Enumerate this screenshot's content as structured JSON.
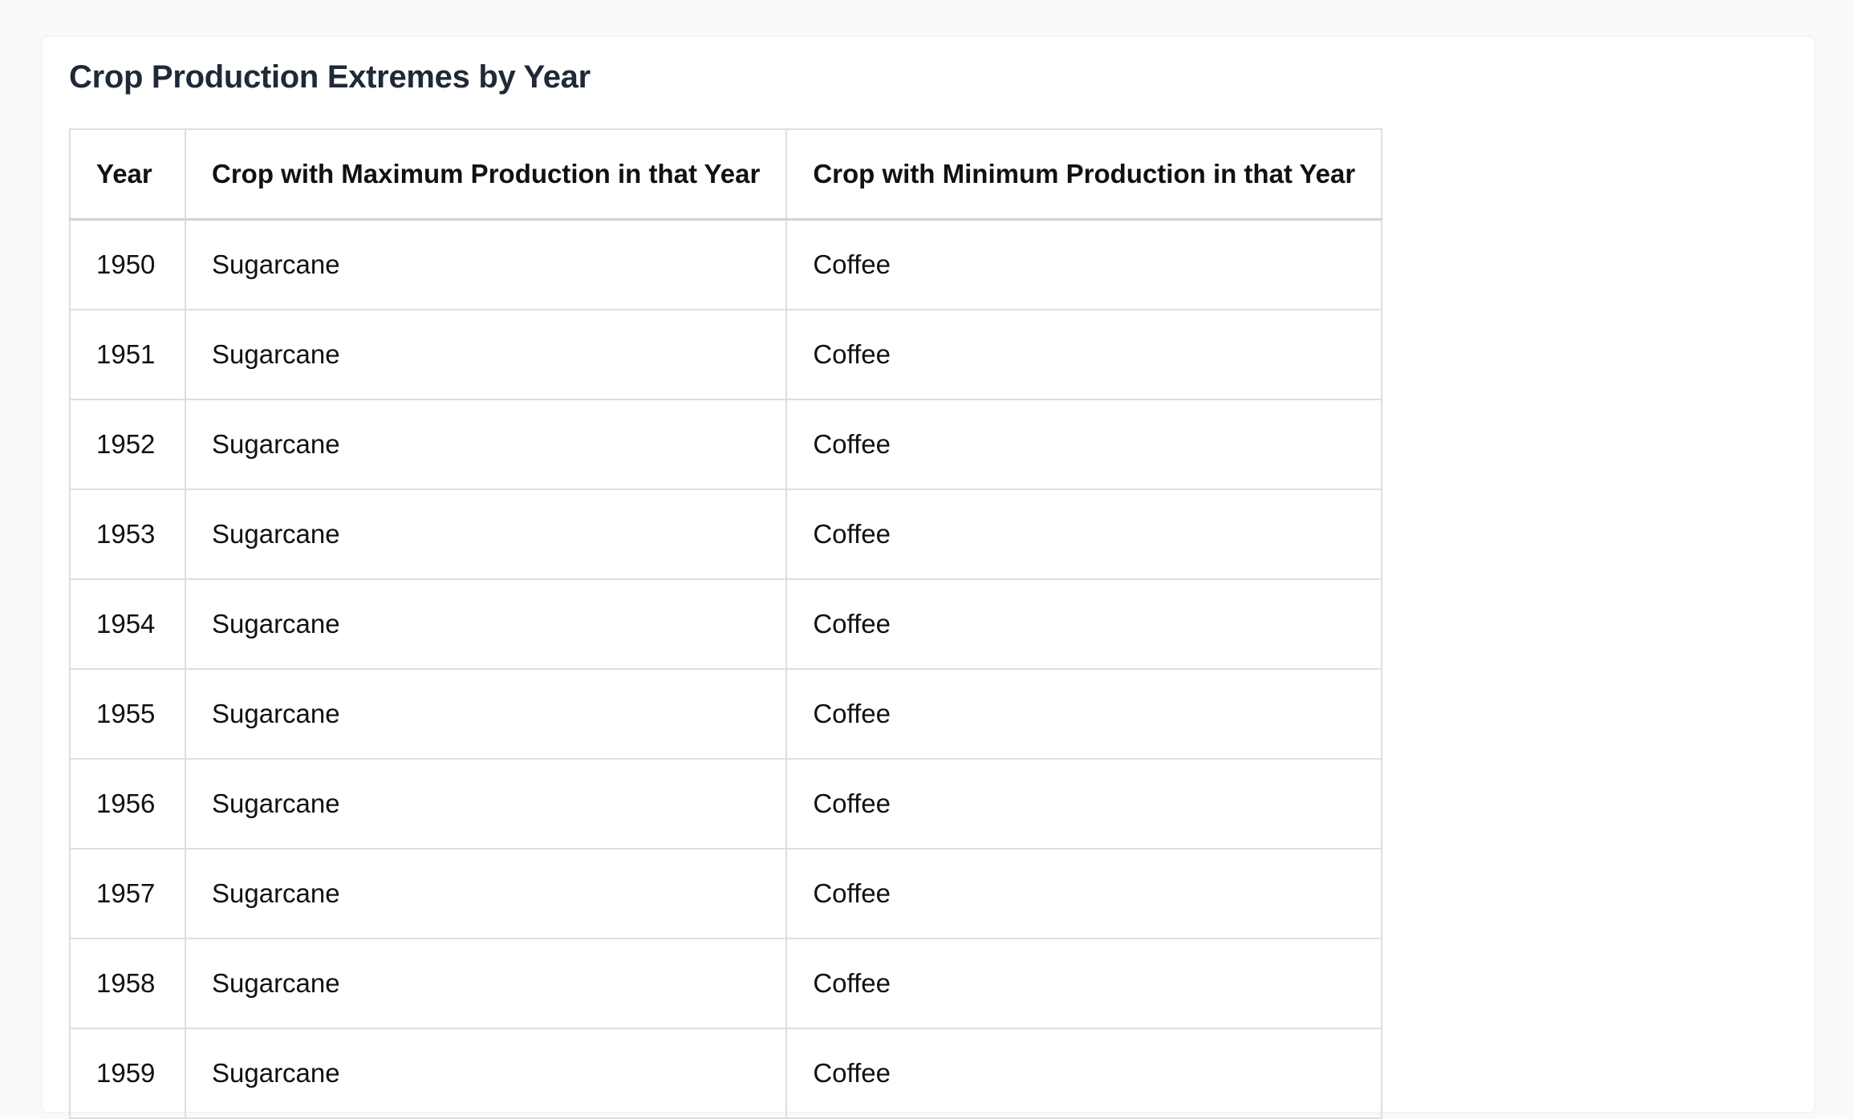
{
  "page": {
    "title": "Crop Production Extremes by Year"
  },
  "table": {
    "headers": [
      "Year",
      "Crop with Maximum Production in that Year",
      "Crop with Minimum Production in that Year"
    ],
    "rows": [
      [
        "1950",
        "Sugarcane",
        "Coffee"
      ],
      [
        "1951",
        "Sugarcane",
        "Coffee"
      ],
      [
        "1952",
        "Sugarcane",
        "Coffee"
      ],
      [
        "1953",
        "Sugarcane",
        "Coffee"
      ],
      [
        "1954",
        "Sugarcane",
        "Coffee"
      ],
      [
        "1955",
        "Sugarcane",
        "Coffee"
      ],
      [
        "1956",
        "Sugarcane",
        "Coffee"
      ],
      [
        "1957",
        "Sugarcane",
        "Coffee"
      ],
      [
        "1958",
        "Sugarcane",
        "Coffee"
      ],
      [
        "1959",
        "Sugarcane",
        "Coffee"
      ]
    ]
  },
  "colors": {
    "title": "#1f2937",
    "border": "#dedede",
    "background": "#fafafa",
    "card": "#ffffff"
  }
}
